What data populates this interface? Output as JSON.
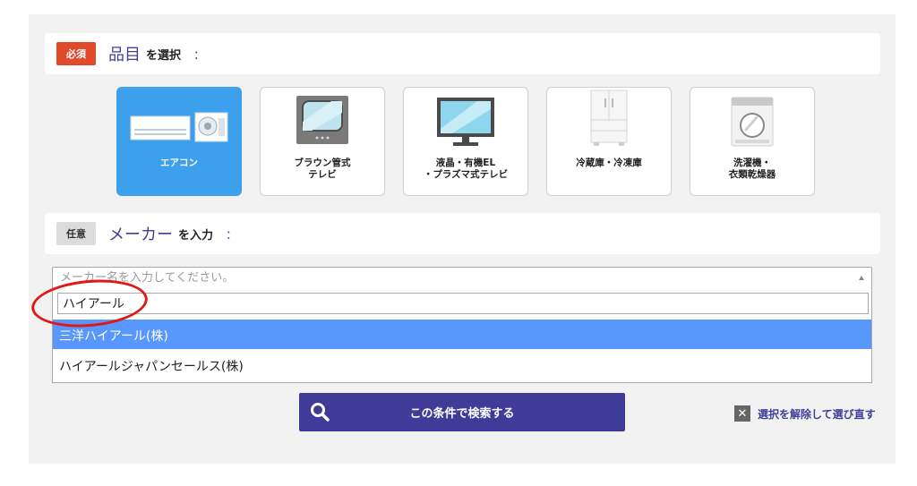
{
  "category": {
    "badge": "必須",
    "title": "品目",
    "rest": "を選択",
    "colon": "：",
    "items": [
      {
        "label": "エアコン",
        "selected": true
      },
      {
        "label": "ブラウン管式\nテレビ",
        "selected": false
      },
      {
        "label": "液晶・有機EL\n・プラズマ式テレビ",
        "selected": false
      },
      {
        "label": "冷蔵庫・冷凍庫",
        "selected": false
      },
      {
        "label": "洗濯機・\n衣類乾燥器",
        "selected": false
      }
    ]
  },
  "maker": {
    "badge": "任意",
    "title": "メーカー",
    "rest": "を入力",
    "colon": "：",
    "placeholder": "メーカー名を入力してください。",
    "search_value": "ハイアール",
    "options": [
      {
        "label": "三洋ハイアール(株)",
        "highlighted": true
      },
      {
        "label": "ハイアールジャパンセールス(株)",
        "highlighted": false
      }
    ]
  },
  "search_button": {
    "label": "この条件で検索する"
  },
  "reset": {
    "label": "選択を解除して選び直す"
  },
  "colors": {
    "accent": "#3e3f99",
    "selected_card": "#3da0ec",
    "required_badge": "#e0492a",
    "highlight_option": "#5897fb",
    "annotation": "#e01818"
  }
}
